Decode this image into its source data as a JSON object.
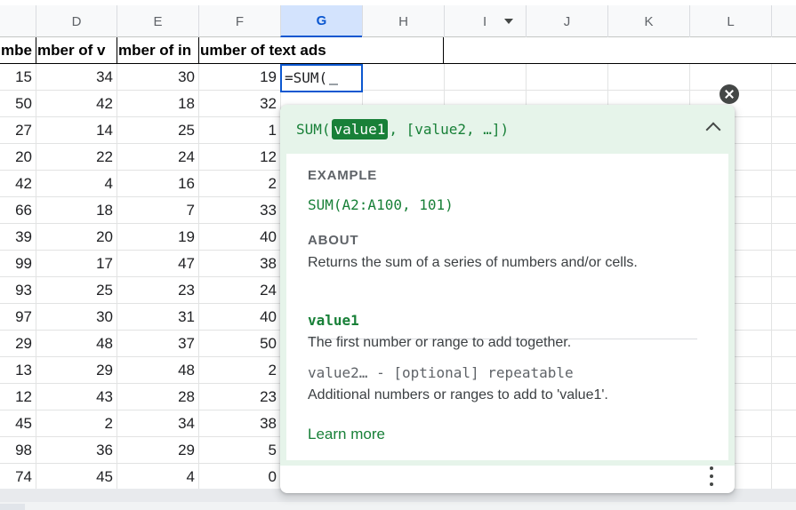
{
  "columns": [
    "D",
    "E",
    "F",
    "G",
    "H",
    "I",
    "J",
    "K",
    "L"
  ],
  "selected_column": "G",
  "header_cells": [
    "mbe",
    "mber of v",
    "mber of in",
    "umber of text ads"
  ],
  "active_cell_value": "=SUM(",
  "rows": [
    [
      "15",
      "34",
      "30",
      "19"
    ],
    [
      "50",
      "42",
      "18",
      "32"
    ],
    [
      "27",
      "14",
      "25",
      "1"
    ],
    [
      "20",
      "22",
      "24",
      "12"
    ],
    [
      "42",
      "4",
      "16",
      "2"
    ],
    [
      "66",
      "18",
      "7",
      "33"
    ],
    [
      "39",
      "20",
      "19",
      "40"
    ],
    [
      "99",
      "17",
      "47",
      "38"
    ],
    [
      "93",
      "25",
      "23",
      "24"
    ],
    [
      "97",
      "30",
      "31",
      "40"
    ],
    [
      "29",
      "48",
      "37",
      "50"
    ],
    [
      "13",
      "29",
      "48",
      "2"
    ],
    [
      "12",
      "43",
      "28",
      "23"
    ],
    [
      "45",
      "2",
      "34",
      "38"
    ],
    [
      "98",
      "36",
      "29",
      "5"
    ],
    [
      "74",
      "45",
      "4",
      "0"
    ]
  ],
  "help": {
    "signature_prefix": "SUM(",
    "signature_highlight": "value1",
    "signature_suffix": ", [value2, …])",
    "example_label": "EXAMPLE",
    "example": "SUM(A2:A100, 101)",
    "about_label": "ABOUT",
    "about_text": "Returns the sum of a series of numbers and/or cells.",
    "arg1_name": "value1",
    "arg1_desc": "The first number or range to add together.",
    "arg2_name": "value2… - [optional] repeatable",
    "arg2_desc": "Additional numbers or ranges to add to 'value1'.",
    "learn_more": "Learn more"
  },
  "icons": {
    "close": "close-icon",
    "collapse": "chevron-up-icon",
    "menu": "more-vert-icon",
    "column_menu": "chevron-down-icon"
  },
  "colors": {
    "accent_blue": "#0b57d0",
    "help_green": "#188038",
    "help_bg": "#e6f4ea"
  }
}
